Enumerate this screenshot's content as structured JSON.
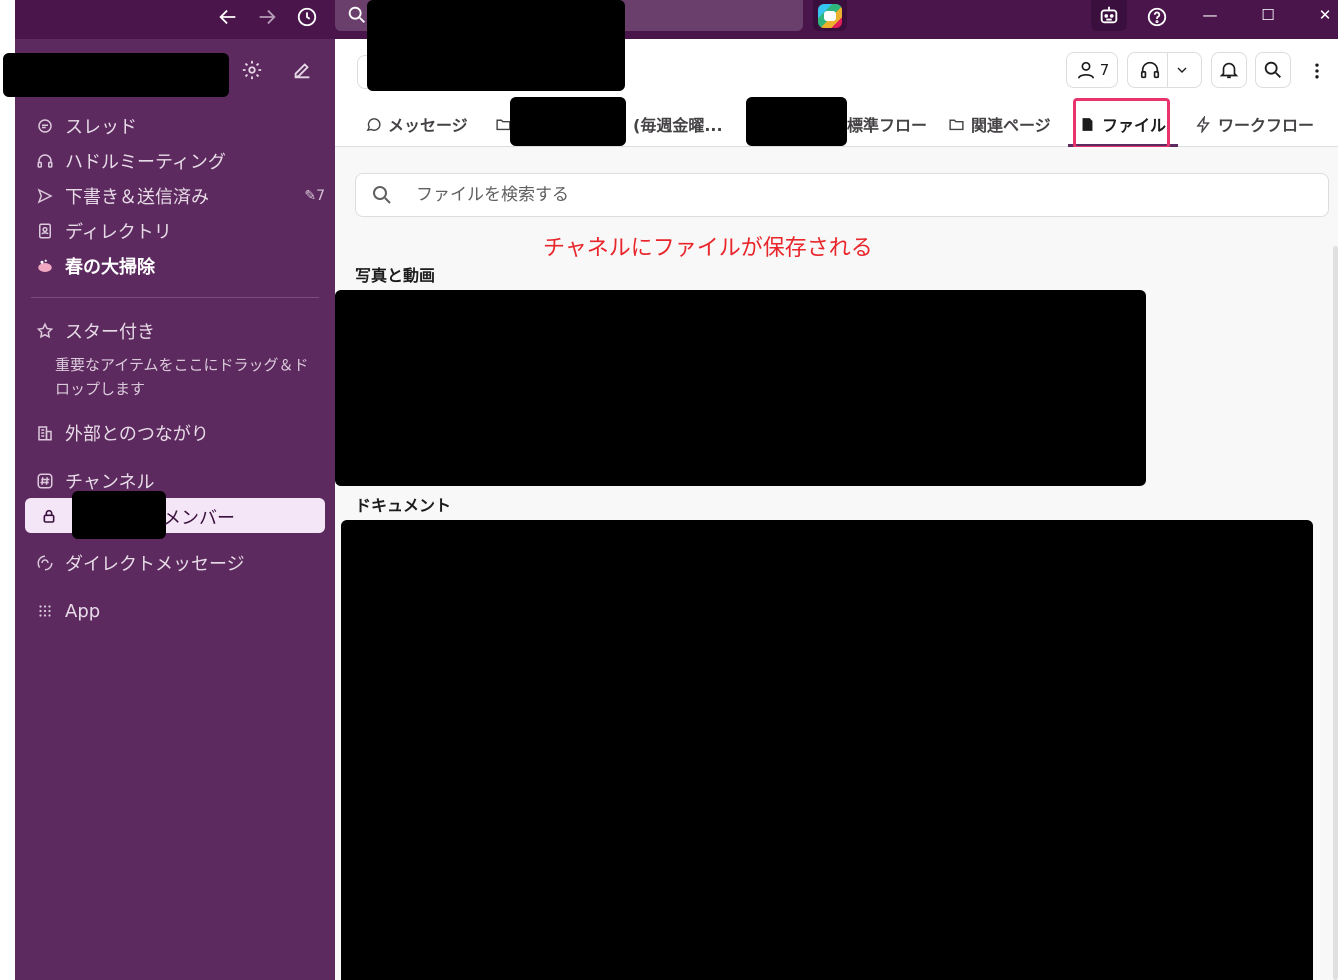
{
  "sidebar": {
    "items": [
      {
        "label": "スレッド",
        "icon": "threads-icon"
      },
      {
        "label": "ハドルミーティング",
        "icon": "headphones-icon"
      },
      {
        "label": "下書き＆送信済み",
        "icon": "send-icon",
        "count": "7"
      },
      {
        "label": "ディレクトリ",
        "icon": "directory-icon"
      },
      {
        "label": "春の大掃除",
        "icon": "soap-icon"
      }
    ],
    "starred": {
      "label": "スター付き",
      "help": "重要なアイテムをここにドラッグ＆ドロップします"
    },
    "external": {
      "label": "外部とのつながり"
    },
    "channels": {
      "label": "チャンネル",
      "active_channel_suffix": "メンバー"
    },
    "dms": {
      "label": "ダイレクトメッセージ"
    },
    "apps": {
      "label": "App"
    }
  },
  "header": {
    "members_count": "7"
  },
  "tabs": [
    {
      "label": "メッセージ",
      "icon": "message-icon"
    },
    {
      "label": "(毎週金曜...",
      "icon": "folder-icon"
    },
    {
      "label": "標準フロー",
      "icon": ""
    },
    {
      "label": "関連ページ",
      "icon": "folder-icon"
    },
    {
      "label": "ファイル",
      "icon": "file-icon",
      "active": true
    },
    {
      "label": "ワークフロー",
      "icon": "bolt-icon"
    }
  ],
  "files": {
    "search_placeholder": "ファイルを検索する",
    "annotation": "チャネルにファイルが保存される",
    "sections": {
      "media": "写真と動画",
      "documents": "ドキュメント"
    }
  },
  "colors": {
    "sidebar": "#5c2a5e",
    "topbar": "#4a154b",
    "highlight": "#e8336d",
    "annotation": "#e8262b"
  }
}
